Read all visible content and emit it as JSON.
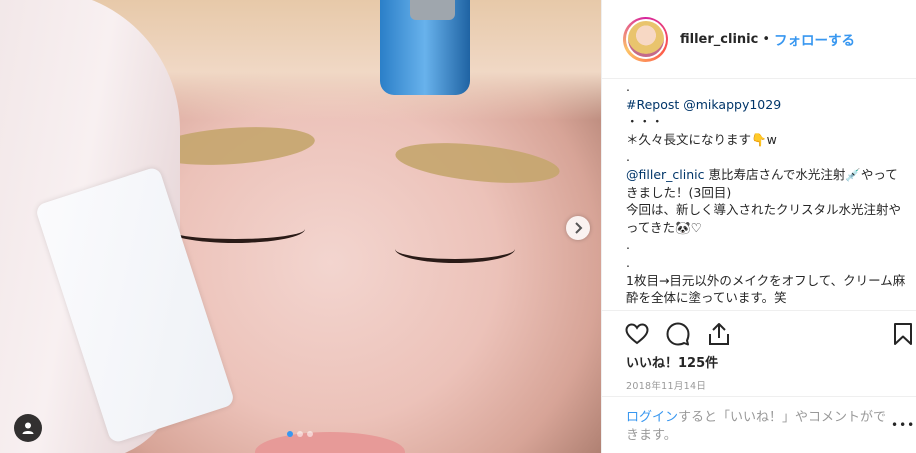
{
  "post": {
    "username": "filler_clinic",
    "separator": "•",
    "follow_label": "フォローする",
    "caption": {
      "line1": ".",
      "repost_tag": "#Repost @mikappy1029",
      "body1": "\n・・・\n＊久々長文になります👇w\n.\n",
      "mention": "@filler_clinic",
      "body2": " 恵比寿店さんで水光注射💉やってきました！(3回目)\n今回は、新しく導入されたクリスタル水光注射やってきた🐼♡\n.\n.\n1枚目→目元以外のメイクをオフして、クリーム麻酔を全体に塗っています。笑"
    },
    "likes": "いいね！125件",
    "date": "2018年11月14日",
    "login_link": "ログイン",
    "login_text": "すると「いいね！」やコメントができます。",
    "more_glyph": "•••"
  },
  "carousel": {
    "total": 3,
    "active_index": 0
  },
  "icons": {
    "like": "heart-icon",
    "comment": "comment-icon",
    "share": "share-icon",
    "save": "bookmark-icon",
    "next": "chevron-right-icon",
    "tag": "user-tag-icon"
  },
  "colors": {
    "accent": "#3897f0",
    "text": "#262626",
    "muted": "#999999"
  }
}
